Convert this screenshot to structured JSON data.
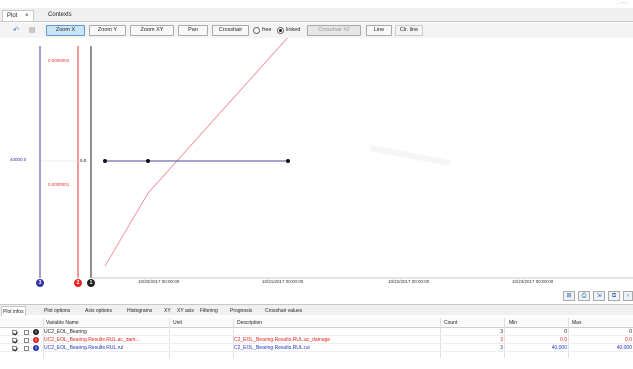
{
  "window": {
    "corner_hint": "— ⎯ ×"
  },
  "tabs": [
    {
      "label": "Plot",
      "close": "×"
    },
    {
      "label": "Contexts"
    }
  ],
  "toolbar": {
    "undo_icon": "undo-icon",
    "redo_icon": "redo-icon",
    "zoom_x": "Zoom X",
    "zoom_y": "Zoom Y",
    "zoom_xy": "Zoom XY",
    "pan": "Pan",
    "crosshair": "Crosshair",
    "free_label": "free",
    "linked_label": "linked",
    "crosshair2": "Crosshair #2",
    "line": "Line",
    "clr_line": "Clr. line",
    "active_mode": "Zoom X",
    "radio_selected": "linked"
  },
  "plot": {
    "axis_blue_value": "40000.0",
    "axis_red_top": "0.0000002",
    "axis_red_mid": "0.0000001",
    "axis_black_value": "0.0",
    "axis_badges": [
      "3",
      "2",
      "1"
    ],
    "x_ticks": [
      "10/20/2017 00:00:00",
      "10/21/2017 00:00:00",
      "10/22/2017 00:00:00",
      "10/23/2017 00:00:00"
    ],
    "colors": {
      "blue": "#3333aa",
      "red": "#ee3333",
      "black": "#222222",
      "pink_line": "#f29aa6",
      "navy_line": "#4a4a9a"
    },
    "mini_buttons": [
      "fit-all-icon",
      "print-icon",
      "export-icon",
      "copy-icon",
      "next-icon"
    ]
  },
  "chart_data": {
    "type": "line",
    "x": [
      "10/19/2017 12:00",
      "10/20/2017 00:00",
      "10/21/2017 00:00"
    ],
    "series": [
      {
        "name": "UC2_EOL_Bearing.Results.RUL.ac_damage",
        "axis": "red",
        "values": [
          0.0,
          7e-08,
          2.2e-07
        ]
      },
      {
        "name": "UC2_EOL_Bearing.Results.RUL.rul",
        "axis": "blue",
        "values": [
          40000,
          40000,
          40000
        ]
      }
    ],
    "y_ticks_red": [
      "0.0000001",
      "0.0000002"
    ],
    "y_ticks_blue": [
      "40000.0"
    ],
    "y_ticks_black": [
      "0.0"
    ],
    "x_tick_labels": [
      "10/20/2017 00:00:00",
      "10/21/2017 00:00:00",
      "10/22/2017 00:00:00",
      "10/23/2017 00:00:00"
    ]
  },
  "bottom_tabs": [
    "Plot infos",
    "Plot options",
    "Axis options",
    "Histograms",
    "XY",
    "XY axis",
    "Filtering",
    "Prognosis",
    "Crosshair values"
  ],
  "table": {
    "headers": {
      "name": "Variable Name",
      "unit": "Unit",
      "description": "Description",
      "count": "Count",
      "min": "Min",
      "max": "Max"
    },
    "rows": [
      {
        "badge": "1",
        "name": "UC2_EOL_Bearing",
        "unit": "",
        "description": "",
        "count": "3",
        "min": "0",
        "max": "0",
        "color": "#222222"
      },
      {
        "badge": "2",
        "name": "UC2_EOL_Bearing.Results.RUL.ac_dam...",
        "unit": "",
        "description": "C2_EOL_Bearing.Results.RUL.ac_damage",
        "count": "3",
        "min": "0.0",
        "max": "0.0",
        "color": "#dd2222"
      },
      {
        "badge": "3",
        "name": "UC2_EOL_Bearing.Results.RUL.rul",
        "unit": "",
        "description": "C2_EOL_Bearing.Results.RUL.rul",
        "count": "3",
        "min": "40,000",
        "max": "40,000",
        "color": "#2233bb"
      }
    ]
  }
}
